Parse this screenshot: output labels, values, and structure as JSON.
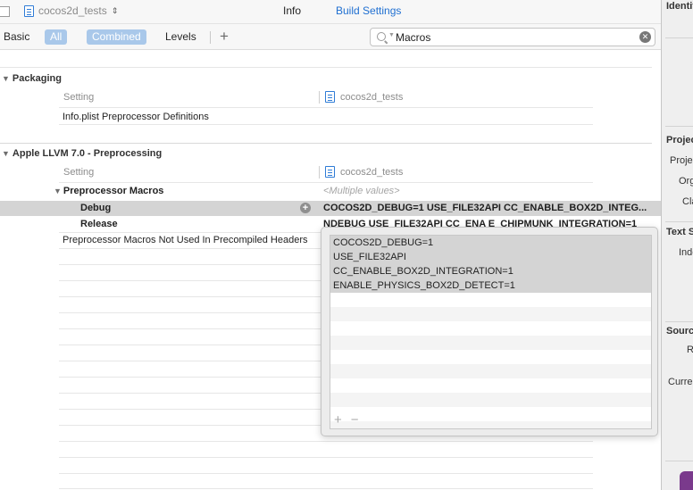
{
  "tabbar": {
    "target_name": "cocos2d_tests",
    "tabs": [
      {
        "label": "Info",
        "active": false
      },
      {
        "label": "Build Settings",
        "active": true
      }
    ]
  },
  "filterbar": {
    "basic": "Basic",
    "all": "All",
    "combined": "Combined",
    "levels": "Levels",
    "add": "+",
    "search_value": "Macros"
  },
  "sections": {
    "packaging": {
      "title": "Packaging",
      "col_setting": "Setting",
      "col_target": "cocos2d_tests",
      "rows": [
        "Info.plist Preprocessor Definitions"
      ]
    },
    "preprocessing": {
      "title": "Apple LLVM 7.0 - Preprocessing",
      "col_setting": "Setting",
      "col_target": "cocos2d_tests",
      "macros_label": "Preprocessor Macros",
      "macros_value": "<Multiple values>",
      "debug_label": "Debug",
      "debug_value": "COCOS2D_DEBUG=1 USE_FILE32API CC_ENABLE_BOX2D_INTEG...",
      "release_label": "Release",
      "release_value": "NDEBUG USE_FILE32API CC_ENA    E_CHIPMUNK_INTEGRATION=1",
      "not_used_label": "Preprocessor Macros Not Used In Precompiled Headers"
    }
  },
  "popover": {
    "items": [
      "COCOS2D_DEBUG=1",
      "USE_FILE32API",
      "CC_ENABLE_BOX2D_INTEGRATION=1",
      "ENABLE_PHYSICS_BOX2D_DETECT=1"
    ],
    "add": "+",
    "remove": "−"
  },
  "inspector": {
    "identity": "Identit",
    "project_header": "Projec",
    "project": "Projec",
    "org": "Org",
    "class": "Cla",
    "text_settings": "Text Se",
    "indent": "Inde",
    "source": "Source",
    "relative": "R",
    "current": "Curren"
  },
  "colors": {
    "accent": "#1f6fd1",
    "pill": "#a9c8ea",
    "selection": "#d4d4d4"
  }
}
